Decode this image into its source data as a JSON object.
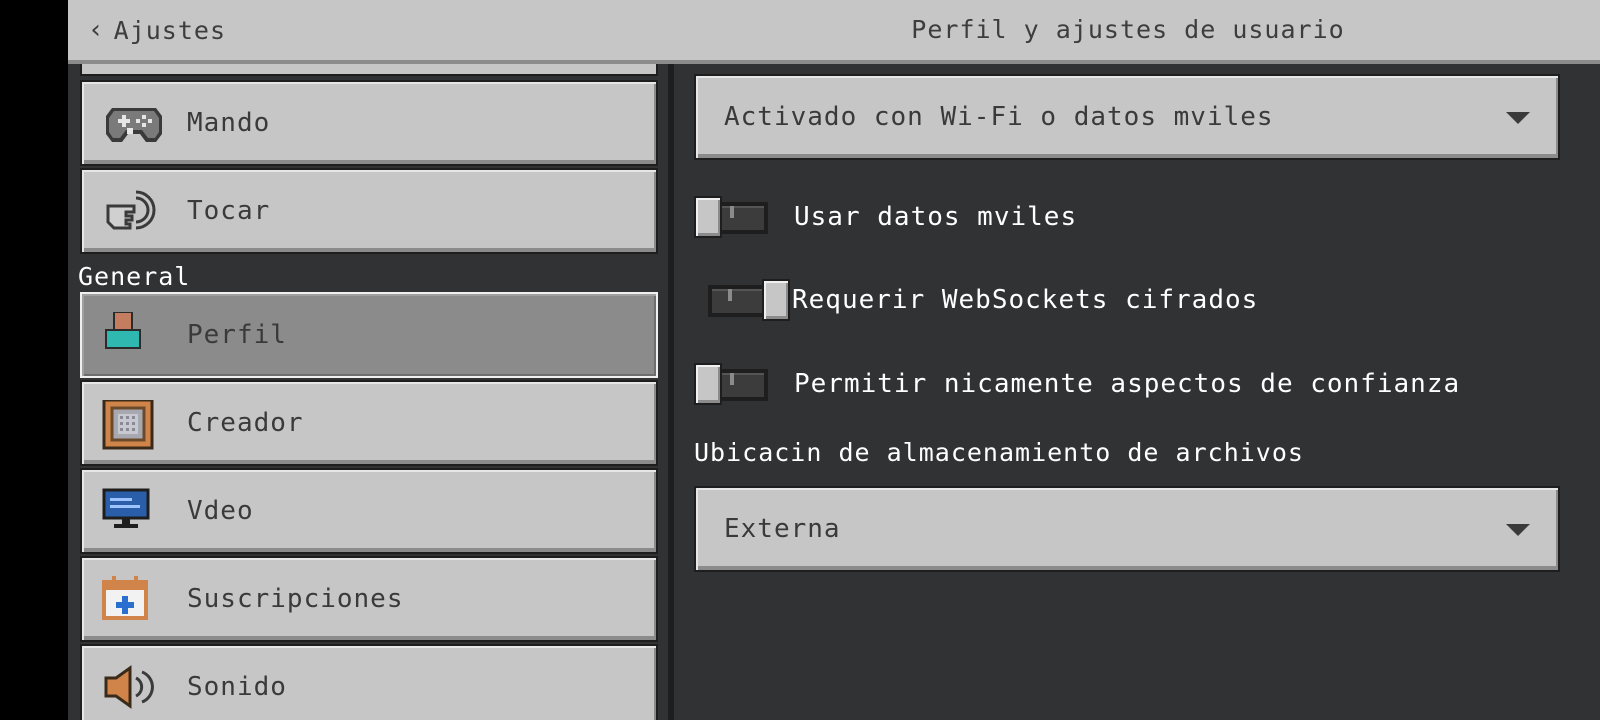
{
  "header": {
    "back_label": "Ajustes",
    "title": "Perfil y ajustes de usuario"
  },
  "sidebar": {
    "section_general": "General",
    "items": [
      {
        "label": "Mando",
        "icon": "gamepad-icon"
      },
      {
        "label": "Tocar",
        "icon": "touch-hand-icon"
      },
      {
        "label": "Perfil",
        "icon": "profile-icon",
        "selected": true
      },
      {
        "label": "Creador",
        "icon": "command-block-icon"
      },
      {
        "label": "Vdeo",
        "icon": "monitor-icon"
      },
      {
        "label": "Suscripciones",
        "icon": "calendar-plus-icon"
      },
      {
        "label": "Sonido",
        "icon": "speaker-icon"
      }
    ]
  },
  "main": {
    "network_dropdown": {
      "value": "Activado con Wi-Fi o datos mviles"
    },
    "toggles": [
      {
        "label": "Usar datos mviles",
        "state": "off"
      },
      {
        "label": "Requerir WebSockets cifrados",
        "state": "on"
      },
      {
        "label": "Permitir nicamente aspectos de confianza",
        "state": "off"
      }
    ],
    "storage_label": "Ubicacin de almacenamiento de archivos",
    "storage_dropdown": {
      "value": "Externa"
    }
  },
  "colors": {
    "panel_bg": "#313233",
    "button_face": "#c6c6c6",
    "selected_face": "#8b8b8b",
    "header_bg": "#c6c6c6",
    "text_light": "#ffffff",
    "text_dark": "#3a3a3a"
  }
}
